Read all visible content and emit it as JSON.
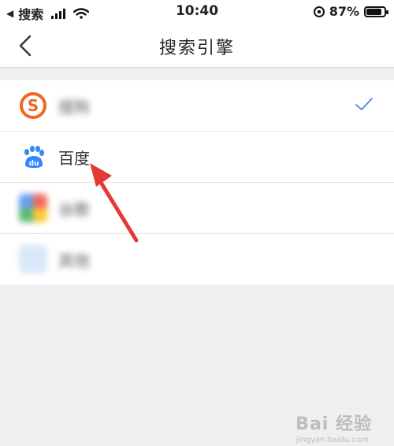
{
  "status_bar": {
    "back_app": "搜索",
    "time": "10:40",
    "battery": "87%",
    "battery_level": 0.87
  },
  "nav": {
    "title": "搜索引擎"
  },
  "engines": [
    {
      "label": "搜狗",
      "icon": "sogou-icon",
      "color": "#f26522",
      "selected": true,
      "blurred": true
    },
    {
      "label": "百度",
      "icon": "baidu-paw-icon",
      "color": "#3388ff",
      "selected": false,
      "blurred": false
    },
    {
      "label": "谷歌",
      "icon": "google-icon",
      "color": "#34a853",
      "selected": false,
      "blurred": true
    },
    {
      "label": "其他",
      "icon": "generic-engine-icon",
      "color": "#b8d4f0",
      "selected": false,
      "blurred": true
    }
  ],
  "colors": {
    "accent": "#5b8fd6",
    "annotation_arrow": "#e53935"
  },
  "watermark": {
    "text": "Bai 经验",
    "sub": "jingyan.baidu.com"
  }
}
